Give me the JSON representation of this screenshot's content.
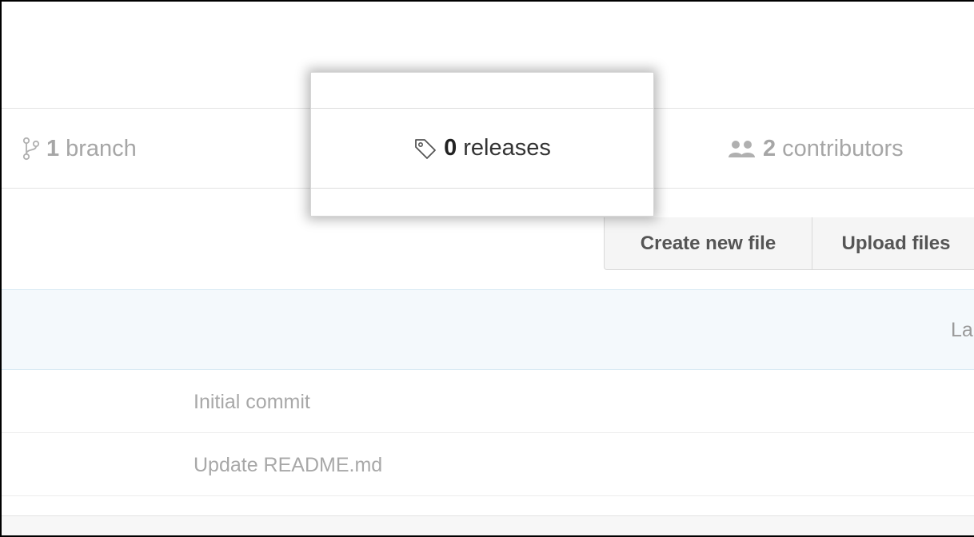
{
  "summary": {
    "branches": {
      "count": "1",
      "label": "branch",
      "icon": "branch-icon"
    },
    "releases": {
      "count": "0",
      "label": "releases",
      "icon": "tag-icon"
    },
    "contributors": {
      "count": "2",
      "label": "contributors",
      "icon": "people-icon"
    }
  },
  "file_actions": {
    "create_label": "Create new file",
    "upload_label": "Upload files"
  },
  "commit_header": {
    "latest_text": "La"
  },
  "file_rows": [
    {
      "message": "Initial commit"
    },
    {
      "message": "Update README.md"
    }
  ],
  "colors": {
    "muted_text": "#a6a6a6",
    "highlight_text": "#333333",
    "commit_header_bg": "#f4f9fc"
  }
}
